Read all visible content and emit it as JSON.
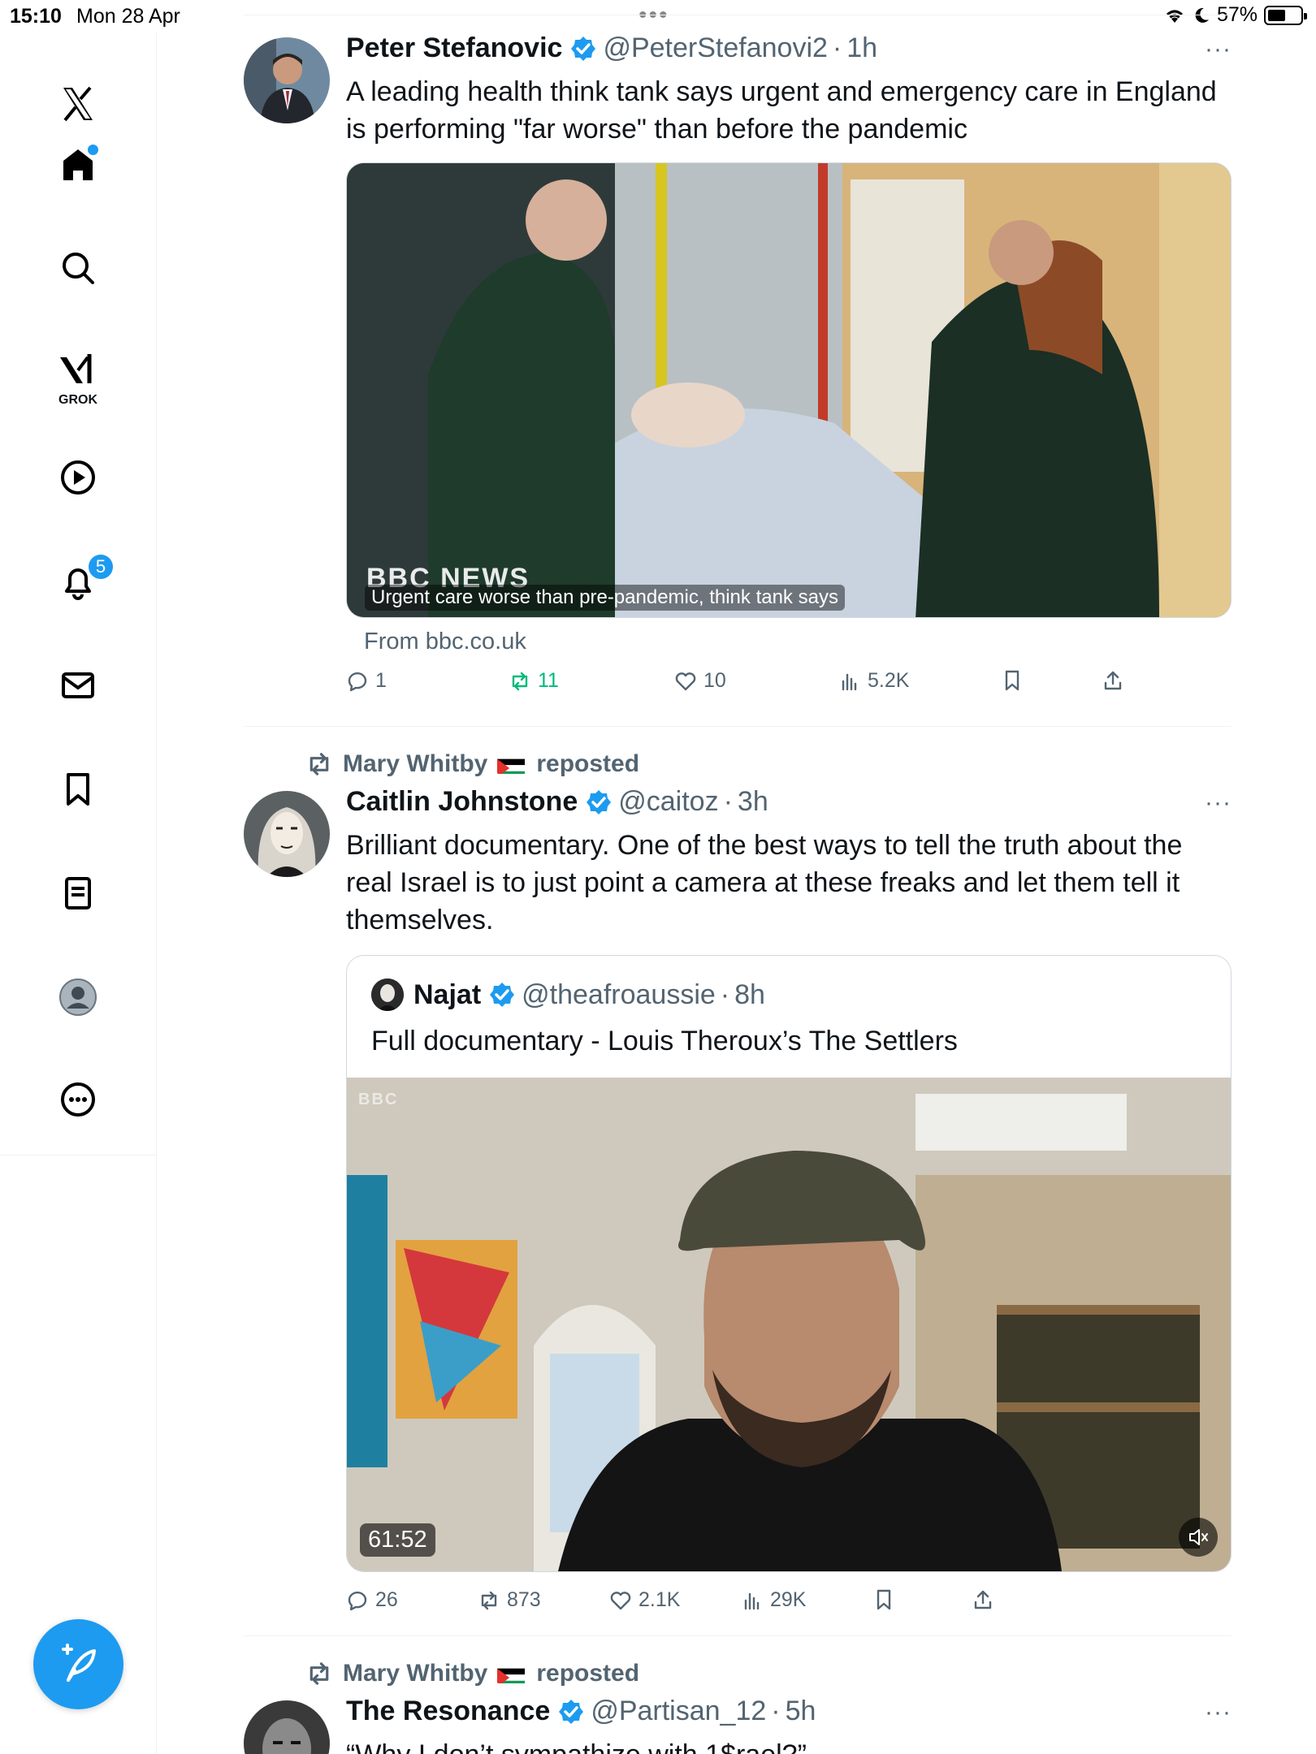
{
  "status_bar": {
    "time": "15:10",
    "date": "Mon 28 Apr",
    "battery": "57%",
    "battery_level": 0.57
  },
  "sidebar": {
    "grok_label": "GROK",
    "notifications_badge": "5"
  },
  "posts": [
    {
      "author": "Peter Stefanovic",
      "handle": "@PeterStefanovi2",
      "time": "1h",
      "separator": "·",
      "more": "···",
      "text": "A leading health think tank says urgent and emergency care in England is performing \"far worse\" than before the pandemic",
      "media": {
        "source_logo": "BBC NEWS",
        "caption": "Urgent care worse than pre-pandemic, think tank says",
        "from": "From bbc.co.uk"
      },
      "stats": {
        "replies": "1",
        "reposts": "11",
        "likes": "10",
        "views": "5.2K"
      }
    },
    {
      "reposted_by": "Mary Whitby",
      "reposted_suffix": "reposted",
      "author": "Caitlin Johnstone",
      "handle": "@caitoz",
      "time": "3h",
      "separator": "·",
      "more": "···",
      "text": "Brilliant documentary. One of the best ways to tell the truth about the real Israel is to just point a camera at these freaks and let them tell it themselves.",
      "quote": {
        "author": "Najat",
        "handle": "@theafroaussie",
        "time": "8h",
        "text": "Full documentary - Louis Theroux’s The Settlers",
        "watermark": "BBC",
        "duration": "61:52"
      },
      "stats": {
        "replies": "26",
        "reposts": "873",
        "likes": "2.1K",
        "views": "29K"
      }
    },
    {
      "reposted_by": "Mary Whitby",
      "reposted_suffix": "reposted",
      "author": "The Resonance",
      "handle": "@Partisan_12",
      "time": "5h",
      "separator": "·",
      "more": "···",
      "text": "“Why I don’t sympathize with 1$rael?”"
    }
  ],
  "colors": {
    "accent": "#1d9bf0",
    "repost_green": "#00ba7c",
    "muted_text": "#536471",
    "border": "#eff3f4"
  }
}
